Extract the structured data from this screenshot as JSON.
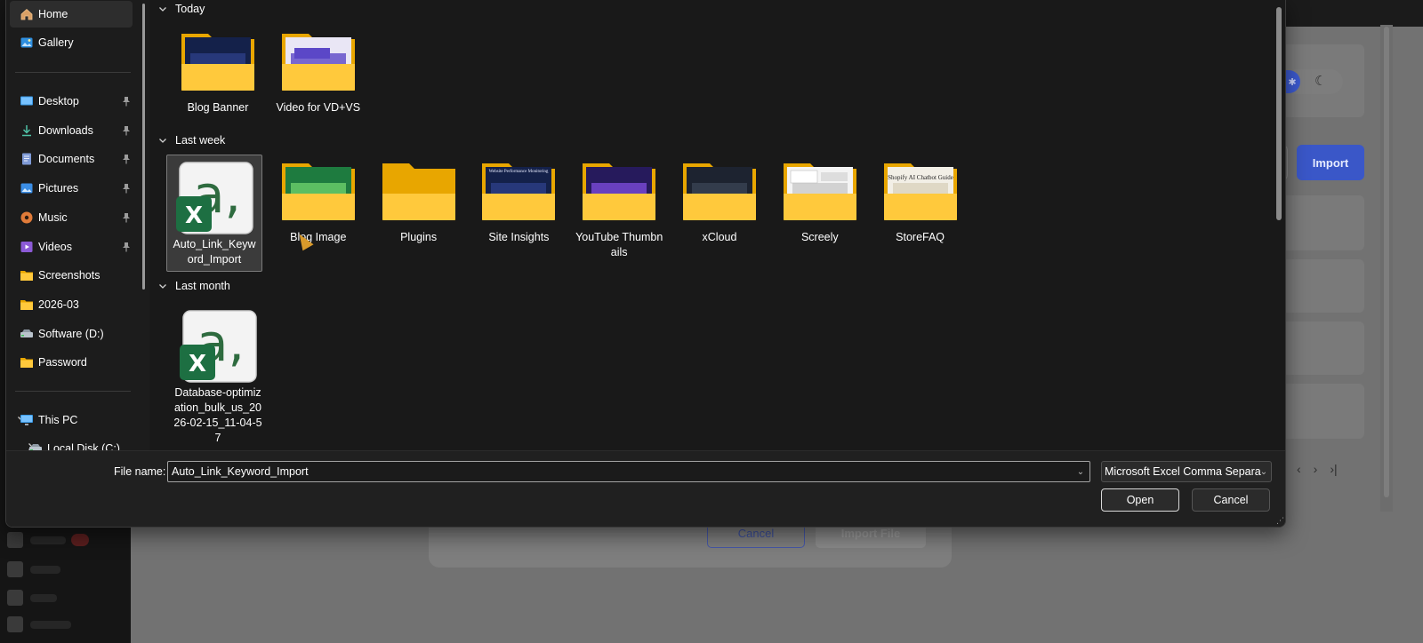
{
  "dialog": {
    "nav": {
      "quick": [
        {
          "label": "Home",
          "icon": "home-icon",
          "selected": true
        },
        {
          "label": "Gallery",
          "icon": "gallery-icon"
        }
      ],
      "pinned": [
        {
          "label": "Desktop",
          "icon": "desktop-icon",
          "pinned": true
        },
        {
          "label": "Downloads",
          "icon": "download-icon",
          "pinned": true
        },
        {
          "label": "Documents",
          "icon": "documents-icon",
          "pinned": true
        },
        {
          "label": "Pictures",
          "icon": "pictures-icon",
          "pinned": true
        },
        {
          "label": "Music",
          "icon": "music-icon",
          "pinned": true
        },
        {
          "label": "Videos",
          "icon": "videos-icon",
          "pinned": true
        },
        {
          "label": "Screenshots",
          "icon": "folder-icon"
        },
        {
          "label": "2026-03",
          "icon": "folder-icon"
        },
        {
          "label": "Software (D:)",
          "icon": "drive-icon"
        },
        {
          "label": "Password",
          "icon": "folder-icon"
        }
      ],
      "this_pc": "This PC",
      "local_disk": "Local Disk (C:)"
    },
    "groups": [
      {
        "label": "Today",
        "items": [
          {
            "name": "Blog Banner",
            "kind": "folder",
            "preview": "dark-blue"
          },
          {
            "name": "Video for VD+VS",
            "kind": "folder",
            "preview": "violet"
          }
        ]
      },
      {
        "label": "Last week",
        "items": [
          {
            "name": "Auto_Link_Keyword_Import",
            "kind": "excel",
            "selected": true
          },
          {
            "name": "Blog Image",
            "kind": "folder",
            "preview": "green"
          },
          {
            "name": "Plugins",
            "kind": "folder",
            "preview": "none"
          },
          {
            "name": "Site Insights",
            "kind": "folder",
            "preview": "dark-blue",
            "preview_text": "Website Performance Monitoring"
          },
          {
            "name": "YouTube Thumbnails",
            "kind": "folder",
            "preview": "purple"
          },
          {
            "name": "xCloud",
            "kind": "folder",
            "preview": "dark"
          },
          {
            "name": "Screely",
            "kind": "folder",
            "preview": "light"
          },
          {
            "name": "StoreFAQ",
            "kind": "folder",
            "preview": "paper",
            "preview_text": "Shopify AI Chatbot Guide"
          }
        ]
      },
      {
        "label": "Last month",
        "items": [
          {
            "name": "Database-optimization_bulk_us_2026-02-15_11-04-57",
            "kind": "excel"
          }
        ]
      }
    ],
    "footer": {
      "file_name_label": "File name:",
      "file_name_value": "Auto_Link_Keyword_Import",
      "file_type": "Microsoft Excel Comma Separa",
      "open_label": "Open",
      "cancel_label": "Cancel"
    }
  },
  "background_page": {
    "import_label": "Import",
    "modal_cancel_label": "Cancel",
    "modal_import_label": "Import File"
  },
  "colors": {
    "folder_back": "#e8a600",
    "folder_front": "#ffc93c",
    "excel_green": "#1d6f42",
    "accent": "#3a57c8"
  }
}
